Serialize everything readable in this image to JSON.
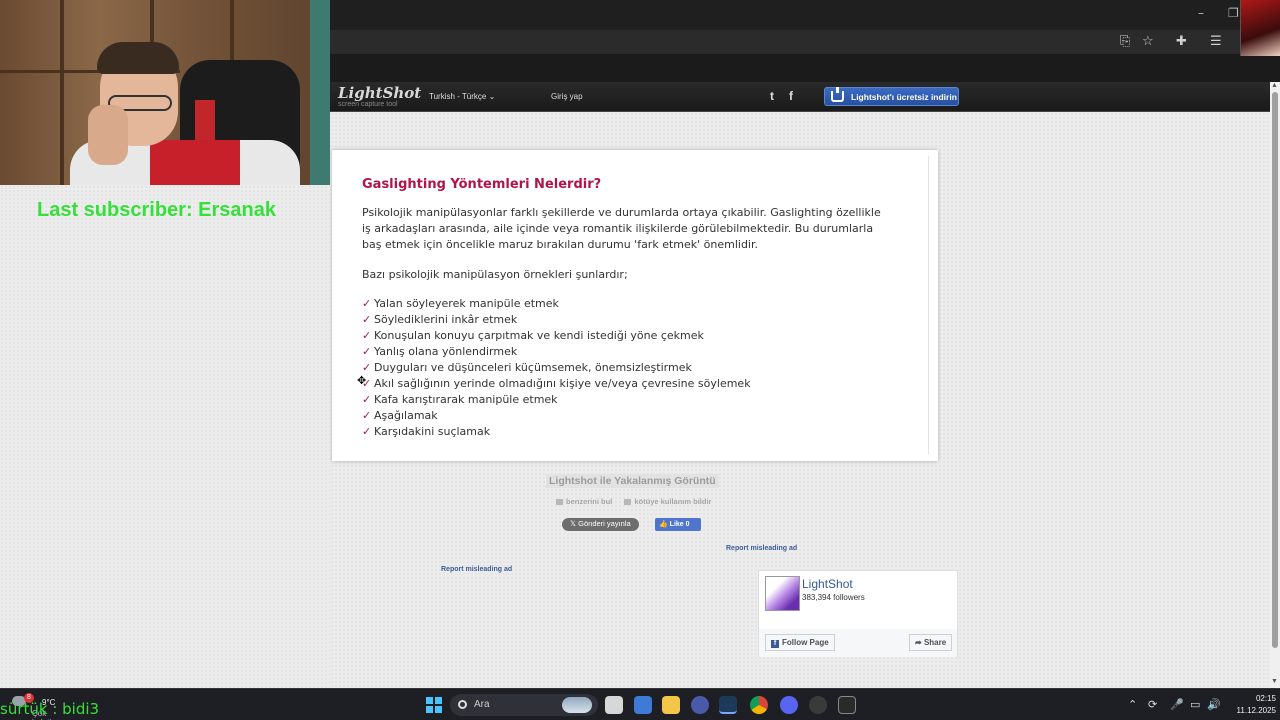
{
  "overlay": {
    "last_subscriber": "Last subscriber: Ersanak",
    "bottom_name": "sürtük : bidi3"
  },
  "lightshot": {
    "logo": "LightShot",
    "tagline": "screen capture tool",
    "language": "Turkish - Türkçe",
    "login": "Giriş yap",
    "twitter_glyph": "t",
    "facebook_glyph": "f",
    "download_button": "Lightshot'ı ücretsiz indirin"
  },
  "article": {
    "title": "Gaslighting Yöntemleri Nelerdir?",
    "paragraph1": "Psikolojik manipülasyonlar farklı şekillerde ve durumlarda ortaya çıkabilir. Gaslighting özellikle iş arkadaşları arasında, aile içinde veya romantik ilişkilerde görülebilmektedir. Bu durumlarla baş etmek için öncelikle maruz bırakılan durumu 'fark etmek' önemlidir.",
    "paragraph2": "Bazı psikolojik manipülasyon örnekleri şunlardır;",
    "checklist": [
      "Yalan söyleyerek manipüle etmek",
      "Söylediklerini inkâr etmek",
      "Konuşulan konuyu çarpıtmak ve kendi istediği yöne çekmek",
      "Yanlış olana yönlendirmek",
      "Duyguları ve düşünceleri küçümsemek, önemsizleştirmek",
      "Akıl sağlığının yerinde olmadığını kişiye ve/veya çevresine söylemek",
      "Kafa karıştırarak manipüle etmek",
      "Aşağılamak",
      "Karşıdakini suçlamak"
    ]
  },
  "capture_info": {
    "caption": "Lightshot ile Yakalanmış Görüntü",
    "find_similar": "benzerini bul",
    "report_abuse": "kötüye kullanım bildir",
    "tweet_button": "Gönderi yayınla",
    "like_button": "Like 0",
    "report_ad_right": "Report misleading ad",
    "report_ad_left": "Report misleading ad"
  },
  "fb_widget": {
    "page_name": "LightShot",
    "followers": "383,394 followers",
    "follow_button": "Follow Page",
    "share_button": "Share"
  },
  "taskbar": {
    "temperature": "9°C",
    "weather_text": "Çok bulutlu",
    "weather_badge": "8",
    "search_placeholder": "Ara",
    "time": "02:15",
    "date": "11.12.2025"
  }
}
